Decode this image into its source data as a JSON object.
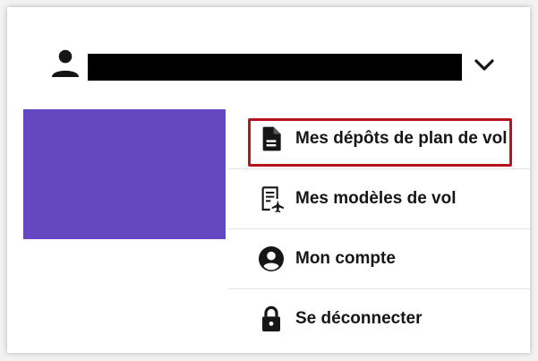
{
  "user_bar": {
    "avatar_icon": "user-icon",
    "username": "",
    "toggle_icon": "chevron-down-icon"
  },
  "menu": {
    "items": [
      {
        "label": "Mes dépôts de plan de vol",
        "icon": "document-icon",
        "highlighted": true
      },
      {
        "label": "Mes modèles de vol",
        "icon": "flight-template-icon",
        "highlighted": false
      },
      {
        "label": "Mon compte",
        "icon": "account-circle-icon",
        "highlighted": false
      },
      {
        "label": "Se déconnecter",
        "icon": "lock-icon",
        "highlighted": false
      }
    ]
  },
  "colors": {
    "accent_purple": "#6548c1",
    "highlight_red": "#b8141e",
    "text": "#161616",
    "divider": "#e3e3e3"
  }
}
